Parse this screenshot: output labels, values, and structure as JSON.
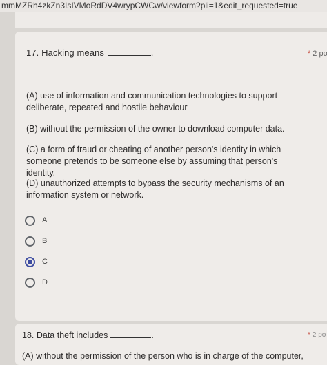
{
  "browser": {
    "url": "mmMZRh4zkZn3IsIVMoRdDV4wrypCWCw/viewform?pli=1&edit_requested=true"
  },
  "question17": {
    "title": "17. Hacking means",
    "title_suffix": ".",
    "required_mark": "*",
    "points": "2 po",
    "options": [
      "(A) use of information and communication technologies to support deliberate, repeated and hostile behaviour",
      "(B) without the permission of the owner to download computer data.",
      "(C) a form of fraud or cheating of another person's identity in which someone pretends to be someone else by assuming that person's identity.",
      "(D) unauthorized attempts to bypass the security mechanisms of an information system or network."
    ],
    "choices": [
      {
        "label": "A",
        "selected": false
      },
      {
        "label": "B",
        "selected": false
      },
      {
        "label": "C",
        "selected": true
      },
      {
        "label": "D",
        "selected": false
      }
    ],
    "accent_color": "#3b4aa0"
  },
  "question18": {
    "title": "18. Data theft includes",
    "title_suffix": ".",
    "required_mark": "*",
    "points": "2 po",
    "option_a": "(A) without the permission of the person who is in charge of the computer,"
  }
}
